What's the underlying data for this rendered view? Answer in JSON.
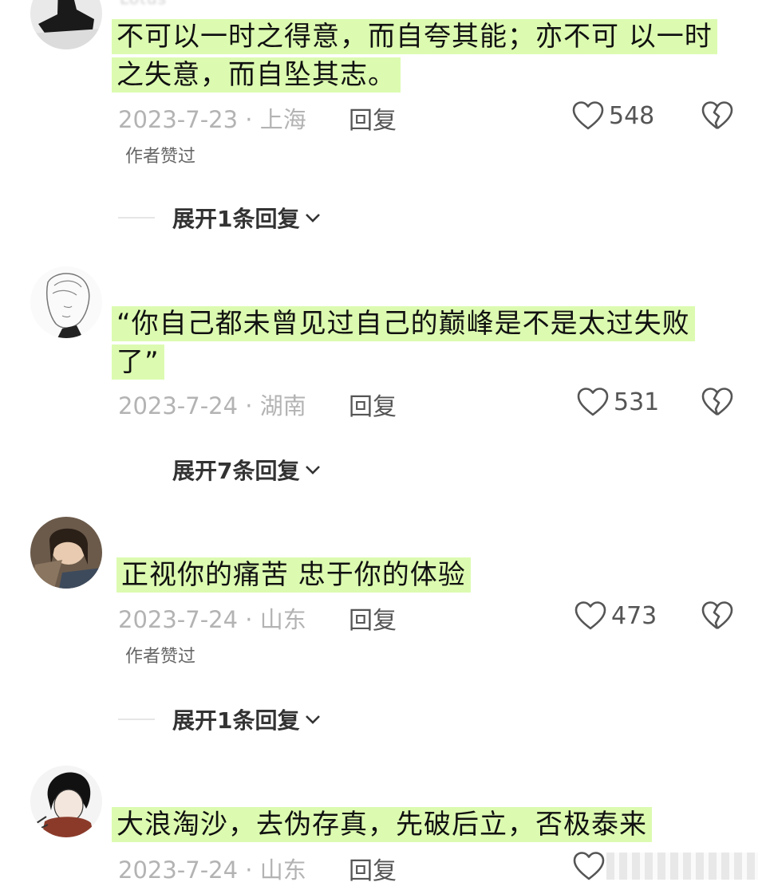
{
  "comments": [
    {
      "username": "Lotus",
      "text": "不可以一时之得意，而自夸其能；亦不可 以一时之失意，而自坠其志。",
      "date_location": "2023-7-23 · 上海",
      "reply_label": "回复",
      "likes": "548",
      "author_liked": "作者赞过",
      "expand_label": "展开1条回复"
    },
    {
      "username": "",
      "text": "“你自己都未曾见过自己的巅峰是不是太过失败了”",
      "date_location": "2023-7-24 · 湖南",
      "reply_label": "回复",
      "likes": "531",
      "expand_label": "展开7条回复"
    },
    {
      "username": "",
      "text": "正视你的痛苦 忠于你的体验",
      "date_location": "2023-7-24 · 山东",
      "reply_label": "回复",
      "likes": "473",
      "author_liked": "作者赞过",
      "expand_label": "展开1条回复"
    },
    {
      "username": "",
      "text": "大浪淘沙，去伪存真，先破后立，否极泰来",
      "date_location": "2023-7-24 · 山东",
      "reply_label": "回复"
    }
  ],
  "colors": {
    "highlight": "#dcfbb0",
    "meta": "#b3b3b3"
  },
  "icons": {
    "like": "heart-outline-icon",
    "dislike": "broken-heart-icon",
    "expand": "chevron-down-icon"
  }
}
